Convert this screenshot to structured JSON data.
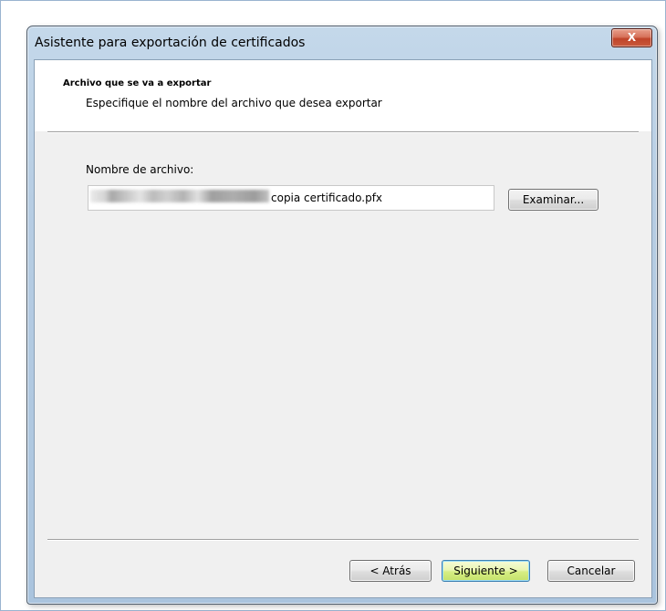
{
  "window": {
    "title": "Asistente para exportación de certificados",
    "close_glyph": "X"
  },
  "header": {
    "title": "Archivo que se va a exportar",
    "subtitle": "Especifique el nombre del archivo que desea exportar"
  },
  "form": {
    "file_label": "Nombre de archivo:",
    "file_value": "copia certificado.pfx",
    "browse_label": "Examinar..."
  },
  "footer": {
    "back_label": "< Atrás",
    "next_label": "Siguiente >",
    "cancel_label": "Cancelar"
  },
  "colors": {
    "close_button": "#c9593c",
    "default_button": "#d6ee84",
    "dialog_background": "#f0f0f0"
  }
}
